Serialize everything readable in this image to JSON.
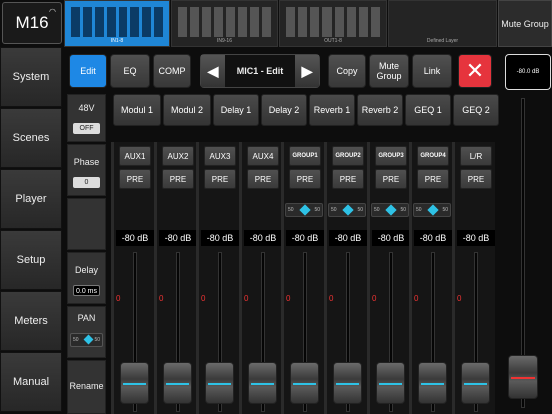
{
  "app": {
    "logo": "M16"
  },
  "sidebar": {
    "items": [
      {
        "label": "System"
      },
      {
        "label": "Scenes"
      },
      {
        "label": "Player"
      },
      {
        "label": "Setup"
      },
      {
        "label": "Meters"
      },
      {
        "label": "Manual"
      }
    ]
  },
  "layers": [
    {
      "label": "IN1-8"
    },
    {
      "label": "IN9-16"
    },
    {
      "label": "OUT1-8"
    },
    {
      "label": "Defined Layer"
    }
  ],
  "top": {
    "mute_group": "Mute Group"
  },
  "toolbar": {
    "edit": "Edit",
    "eq": "EQ",
    "comp": "COMP",
    "channel": "MIC1 - Edit",
    "copy": "Copy",
    "mute_group": "Mute Group",
    "link": "Link"
  },
  "master": {
    "level": "-80.0 dB"
  },
  "channel_strip": {
    "phantom": "48V",
    "phantom_state": "OFF",
    "phase": "Phase",
    "phase_value": "0",
    "delay": "Delay",
    "delay_value": "0.0 ms",
    "pan": "PAN",
    "pan_left": "50",
    "pan_right": "50",
    "rename": "Rename"
  },
  "fx": [
    "Modul 1",
    "Modul 2",
    "Delay 1",
    "Delay 2",
    "Reverb 1",
    "Reverb 2",
    "GEQ 1",
    "GEQ 2"
  ],
  "sends": [
    {
      "name": "AUX1",
      "mode": "PRE",
      "level": "-80 dB",
      "zero": "0",
      "pan": false
    },
    {
      "name": "AUX2",
      "mode": "PRE",
      "level": "-80 dB",
      "zero": "0",
      "pan": false
    },
    {
      "name": "AUX3",
      "mode": "PRE",
      "level": "-80 dB",
      "zero": "0",
      "pan": false
    },
    {
      "name": "AUX4",
      "mode": "PRE",
      "level": "-80 dB",
      "zero": "0",
      "pan": false
    },
    {
      "name": "GROUP1",
      "mode": "PRE",
      "level": "-80 dB",
      "zero": "0",
      "pan": true,
      "pan_l": "50",
      "pan_r": "50"
    },
    {
      "name": "GROUP2",
      "mode": "PRE",
      "level": "-80 dB",
      "zero": "0",
      "pan": true,
      "pan_l": "50",
      "pan_r": "50"
    },
    {
      "name": "GROUP3",
      "mode": "PRE",
      "level": "-80 dB",
      "zero": "0",
      "pan": true,
      "pan_l": "50",
      "pan_r": "50"
    },
    {
      "name": "GROUP4",
      "mode": "PRE",
      "level": "-80 dB",
      "zero": "0",
      "pan": true,
      "pan_l": "50",
      "pan_r": "50"
    },
    {
      "name": "L/R",
      "mode": "PRE",
      "level": "-80 dB",
      "zero": "0",
      "pan": false
    }
  ],
  "colors": {
    "accent": "#1e88e5",
    "close": "#e6343d",
    "pan_marker": "#2ec2e6",
    "zero_mark": "#e33333"
  }
}
